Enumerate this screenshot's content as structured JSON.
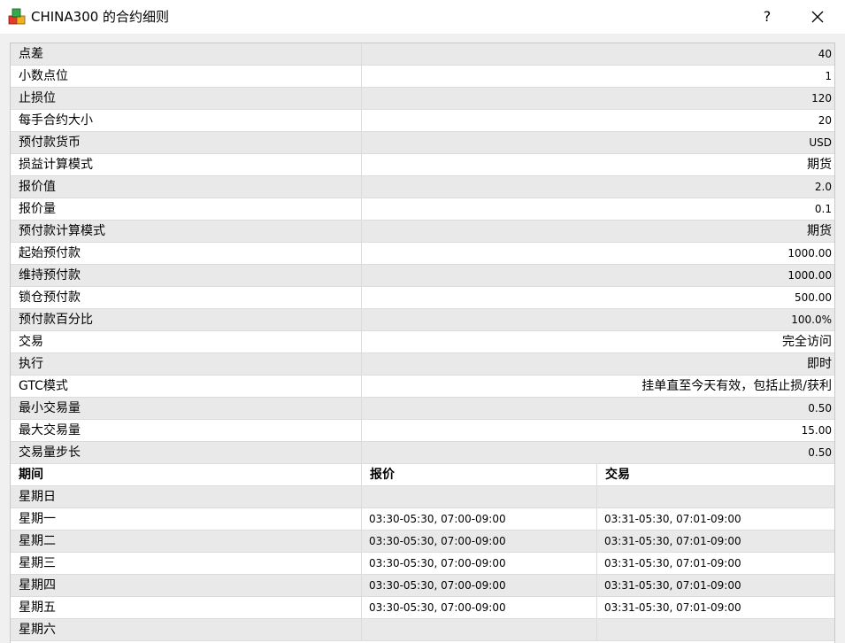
{
  "window": {
    "title": "CHINA300 的合约细则",
    "help_label": "?",
    "app_icon": "app-cubes-icon",
    "close_icon": "close-icon"
  },
  "specs": [
    {
      "label": "点差",
      "value": "40"
    },
    {
      "label": "小数点位",
      "value": "1"
    },
    {
      "label": "止损位",
      "value": "120"
    },
    {
      "label": "每手合约大小",
      "value": "20"
    },
    {
      "label": "预付款货币",
      "value": "USD"
    },
    {
      "label": "损益计算模式",
      "value": "期货"
    },
    {
      "label": "报价值",
      "value": "2.0"
    },
    {
      "label": "报价量",
      "value": "0.1"
    },
    {
      "label": "预付款计算模式",
      "value": "期货"
    },
    {
      "label": "起始预付款",
      "value": "1000.00"
    },
    {
      "label": "维持预付款",
      "value": "1000.00"
    },
    {
      "label": "锁仓预付款",
      "value": "500.00"
    },
    {
      "label": "预付款百分比",
      "value": "100.0%"
    },
    {
      "label": "交易",
      "value": "完全访问"
    },
    {
      "label": "执行",
      "value": "即时"
    },
    {
      "label": "GTC模式",
      "value": "挂单直至今天有效，包括止损/获利"
    },
    {
      "label": "最小交易量",
      "value": "0.50"
    },
    {
      "label": "最大交易量",
      "value": "15.00"
    },
    {
      "label": "交易量步长",
      "value": "0.50"
    }
  ],
  "sessions_header": {
    "period": "期间",
    "quotes": "报价",
    "trades": "交易"
  },
  "sessions": [
    {
      "day": "星期日",
      "quotes": "",
      "trades": ""
    },
    {
      "day": "星期一",
      "quotes": "03:30-05:30, 07:00-09:00",
      "trades": "03:31-05:30, 07:01-09:00"
    },
    {
      "day": "星期二",
      "quotes": "03:30-05:30, 07:00-09:00",
      "trades": "03:31-05:30, 07:01-09:00"
    },
    {
      "day": "星期三",
      "quotes": "03:30-05:30, 07:00-09:00",
      "trades": "03:31-05:30, 07:01-09:00"
    },
    {
      "day": "星期四",
      "quotes": "03:30-05:30, 07:00-09:00",
      "trades": "03:31-05:30, 07:01-09:00"
    },
    {
      "day": "星期五",
      "quotes": "03:30-05:30, 07:00-09:00",
      "trades": "03:31-05:30, 07:01-09:00"
    },
    {
      "day": "星期六",
      "quotes": "",
      "trades": ""
    }
  ]
}
